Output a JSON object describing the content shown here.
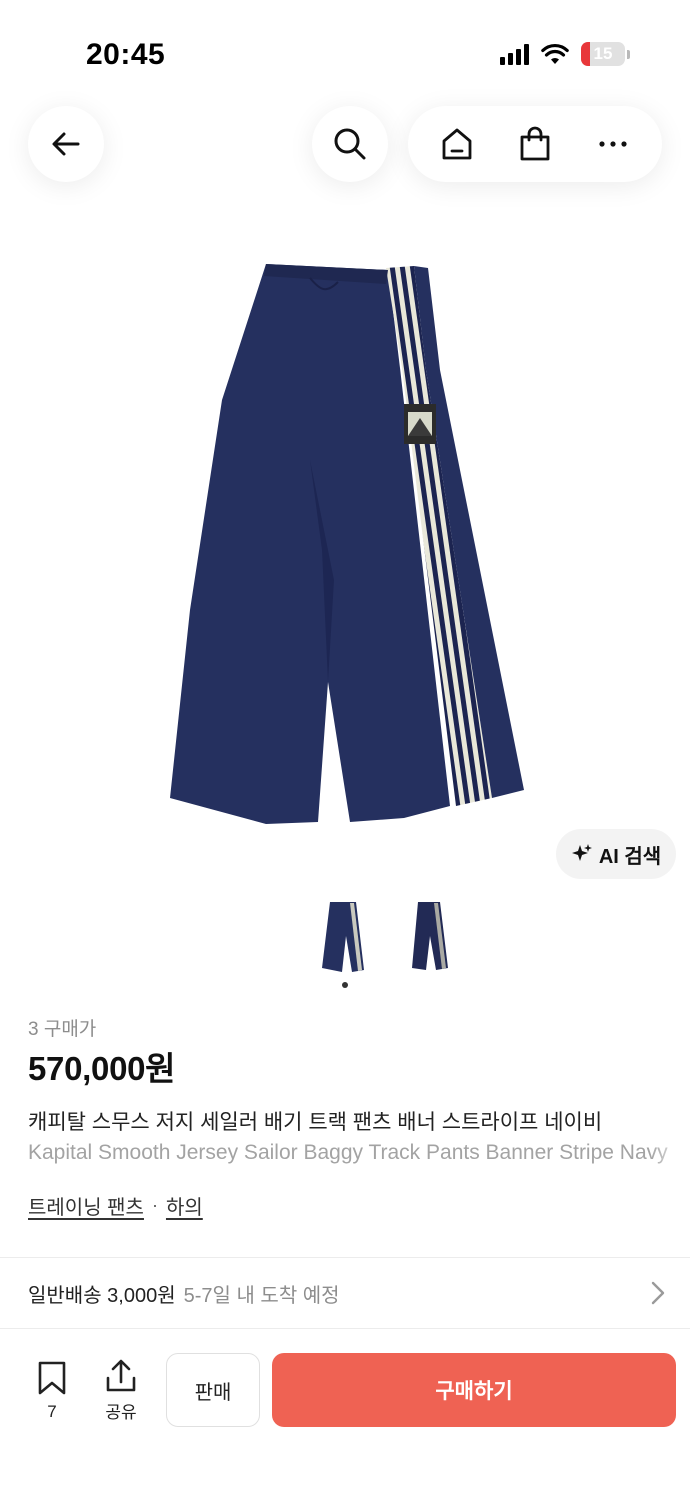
{
  "status_bar": {
    "time": "20:45",
    "battery_level": "15",
    "icons": [
      "signal-icon",
      "wifi-icon",
      "battery-icon"
    ]
  },
  "nav": {
    "icons": [
      "back-arrow-icon",
      "search-icon",
      "home-icon",
      "shopping-bag-icon",
      "more-icon"
    ]
  },
  "product": {
    "ai_search_label": "AI 검색",
    "thumbnail_count": 2,
    "purchase_count": "3 구매가",
    "price": "570,000원",
    "title_ko": "캐피탈 스무스 저지 세일러 배기 트랙 팬츠 배너 스트라이프 네이비",
    "title_en": "Kapital Smooth Jersey Sailor Baggy Track Pants Banner Stripe Navy",
    "category_1": "트레이닝 팬츠",
    "category_separator": "·",
    "category_2": "하의"
  },
  "shipping": {
    "main": "일반배송 3,000원",
    "sub": "5-7일 내 도착 예정"
  },
  "bottom_bar": {
    "bookmark_count": "7",
    "share_label": "공유",
    "sell_label": "판매",
    "buy_label": "구매하기"
  },
  "colors": {
    "accent": "#ef6253",
    "product_navy": "#25305f",
    "stripe": "#e8e8dc"
  }
}
